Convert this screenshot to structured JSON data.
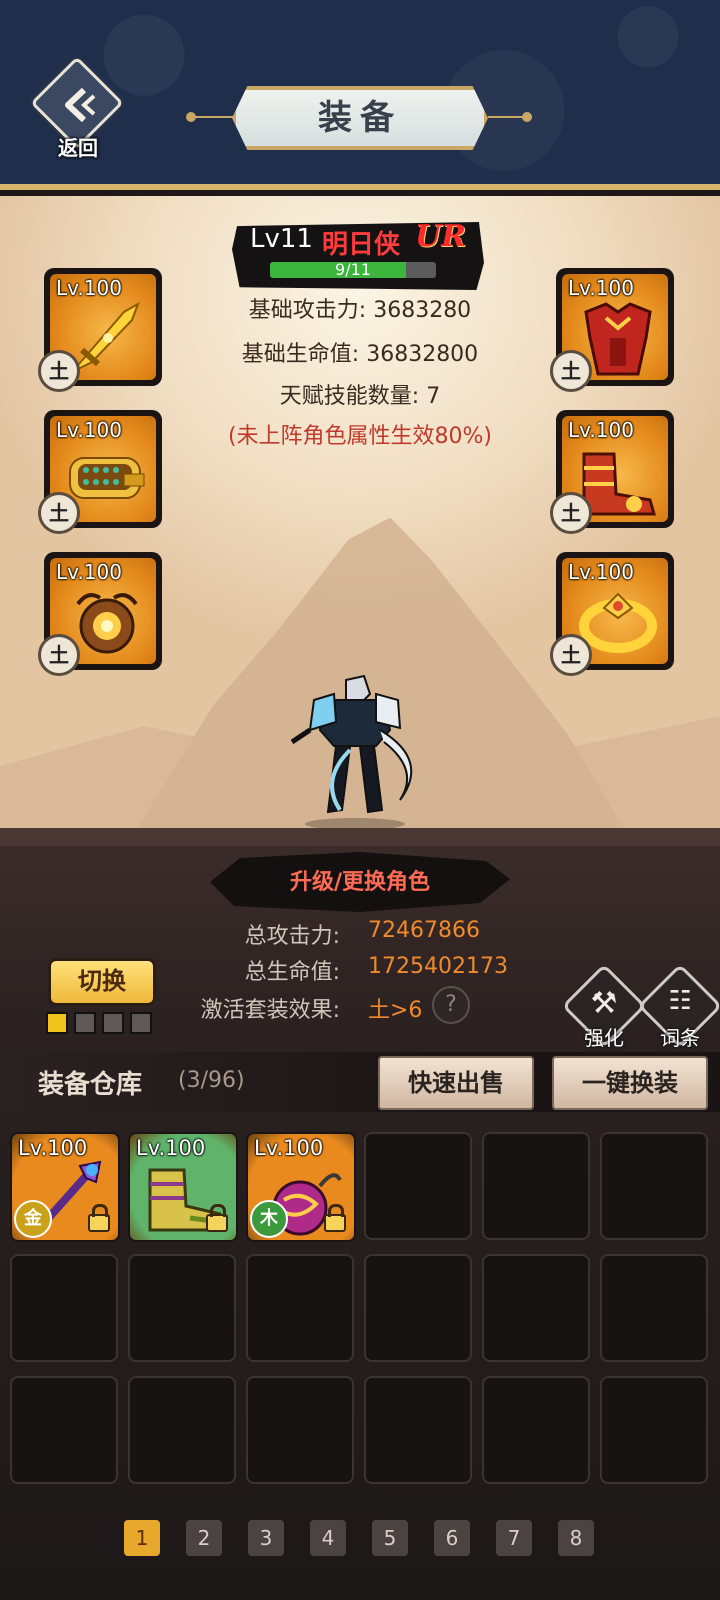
{
  "header": {
    "back_label": "返回",
    "title": "装备"
  },
  "hero": {
    "level": "Lv11",
    "name": "明日侠",
    "rarity": "UR",
    "progress_text": "9/11",
    "progress_fraction": 0.818,
    "base_attack": "基础攻击力: 3683280",
    "base_hp": "基础生命值: 36832800",
    "talent_count": "天赋技能数量: 7",
    "note": "(未上阵角色属性生效80%)"
  },
  "equipped": [
    {
      "level": "Lv.100",
      "element": "土",
      "item": "sword"
    },
    {
      "level": "Lv.100",
      "element": "土",
      "item": "armor"
    },
    {
      "level": "Lv.100",
      "element": "土",
      "item": "belt"
    },
    {
      "level": "Lv.100",
      "element": "土",
      "item": "boots"
    },
    {
      "level": "Lv.100",
      "element": "土",
      "item": "amulet"
    },
    {
      "level": "Lv.100",
      "element": "土",
      "item": "ring"
    }
  ],
  "upgrade_banner": "升级/更换角色",
  "totals": {
    "attack_label": "总攻击力:",
    "attack_value": "72467866",
    "hp_label": "总生命值:",
    "hp_value": "1725402173",
    "set_label": "激活套装效果:",
    "set_value": "土>6"
  },
  "switch": {
    "label": "切换",
    "slots_active": 1,
    "slots_total": 4
  },
  "side_buttons": {
    "enhance_label": "强化",
    "affix_label": "词条"
  },
  "storage": {
    "title": "装备仓库",
    "count": "(3/96)",
    "quick_sell": "快速出售",
    "one_click_equip": "一键换装",
    "items": [
      {
        "level": "Lv.100",
        "element": "金",
        "rarity_color": "#e88a1e",
        "element_color": "#c9a21a",
        "item": "staff"
      },
      {
        "level": "Lv.100",
        "element": "",
        "rarity_color": "#5fb36a",
        "element_color": "",
        "item": "boots"
      },
      {
        "level": "Lv.100",
        "element": "木",
        "rarity_color": "#e88a1e",
        "element_color": "#3c9a3c",
        "item": "orb"
      }
    ]
  },
  "pagination": {
    "pages": [
      "1",
      "2",
      "3",
      "4",
      "5",
      "6",
      "7",
      "8"
    ],
    "current": "1"
  },
  "colors": {
    "header_bg": "#1f2e4a",
    "accent_gold": "#e7a82c",
    "stat_orange": "#f08a2e",
    "rarity_red": "#ff2b2b"
  }
}
